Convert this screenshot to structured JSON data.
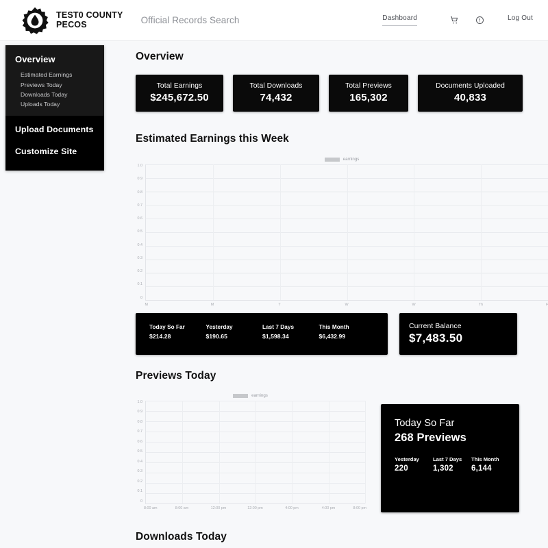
{
  "header": {
    "brand_name": "TEST0 COUNTY\nPECOS",
    "logo_icon": "gear-droplet-icon",
    "tagline": "Official Records Search",
    "nav": {
      "dashboard": "Dashboard",
      "cart_icon": "shopping-cart-icon",
      "help_icon": "help-circle-icon",
      "logout": "Log Out"
    }
  },
  "sidebar": {
    "overview": "Overview",
    "sub_items": [
      "Estimated Earnings",
      "Previews Today",
      "Downloads Today",
      "Uploads Today"
    ],
    "upload_documents": "Upload Documents",
    "customize_site": "Customize Site"
  },
  "main": {
    "overview_title": "Overview",
    "stats": [
      {
        "label": "Total Earnings",
        "value": "$245,672.50"
      },
      {
        "label": "Total Downloads",
        "value": "74,432"
      },
      {
        "label": "Total Previews",
        "value": "165,302"
      },
      {
        "label": "Documents Uploaded",
        "value": "40,833"
      }
    ],
    "earnings_section": {
      "title": "Estimated Earnings this Week",
      "summary": [
        {
          "label": "Today So Far",
          "value": "$214.28"
        },
        {
          "label": "Yesterday",
          "value": "$190.65"
        },
        {
          "label": "Last 7 Days",
          "value": "$1,598.34"
        },
        {
          "label": "This Month",
          "value": "$6,432.99"
        }
      ],
      "balance_label": "Current Balance",
      "balance_value": "$7,483.50"
    },
    "previews_section": {
      "title": "Previews Today",
      "today_label": "Today So Far",
      "today_value": "268 Previews",
      "stats": [
        {
          "label": "Yesterday",
          "value": "220"
        },
        {
          "label": "Last 7 Days",
          "value": "1,302"
        },
        {
          "label": "This Month",
          "value": "6,144"
        }
      ]
    },
    "downloads_section": {
      "title": "Downloads Today"
    }
  },
  "colors": {
    "page_bg": "#f7f8fa",
    "card_bg": "#000000",
    "header_bg": "#ffffff",
    "sidebar_top": "#181818",
    "sidebar_bottom": "#000000",
    "grid": "#e9ebef",
    "muted_text": "#a9acb2",
    "legend_swatch": "#c6c8cb"
  },
  "chart_data": [
    {
      "type": "line",
      "title": "Estimated Earnings this Week",
      "legend": [
        "earnings"
      ],
      "legend_position": "top-center",
      "xlabel": "",
      "ylabel": "",
      "ylim": [
        0,
        1.0
      ],
      "yticks": [
        "1.0",
        "0.9",
        "0.8",
        "0.7",
        "0.6",
        "0.5",
        "0.4",
        "0.3",
        "0.2",
        "0.1",
        "0"
      ],
      "xticks": [
        "M",
        "M",
        "T",
        "W",
        "W",
        "Th",
        "F"
      ],
      "grid": true,
      "series": [
        {
          "name": "earnings",
          "values": []
        }
      ],
      "note": "no data plotted — empty series"
    },
    {
      "type": "line",
      "title": "Previews Today",
      "legend": [
        "earnings"
      ],
      "legend_position": "top-center",
      "xlabel": "",
      "ylabel": "",
      "ylim": [
        0,
        1.0
      ],
      "yticks": [
        "1.0",
        "0.9",
        "0.8",
        "0.7",
        "0.6",
        "0.5",
        "0.4",
        "0.3",
        "0.2",
        "0.1",
        "0"
      ],
      "xticks": [
        "8:00 am",
        "8:00 am",
        "12:00 pm",
        "12:00 pm",
        "4:00 pm",
        "4:00 pm",
        "8:00 pm"
      ],
      "grid": true,
      "series": [
        {
          "name": "earnings",
          "values": []
        }
      ],
      "note": "no data plotted — empty series"
    }
  ]
}
